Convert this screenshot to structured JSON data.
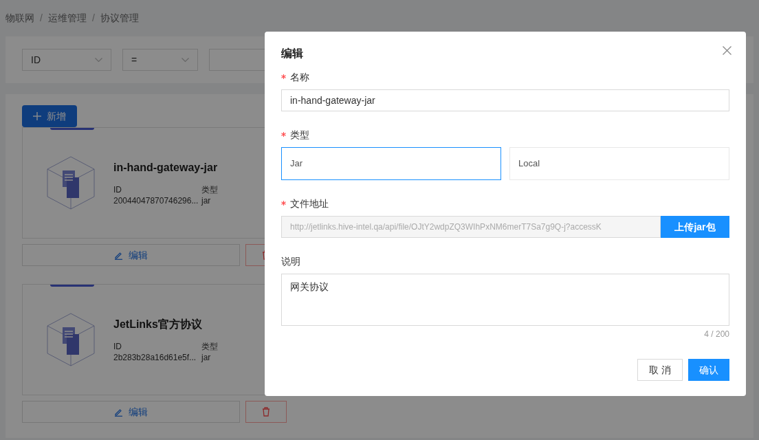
{
  "breadcrumb": [
    "物联网",
    "运维管理",
    "协议管理"
  ],
  "breadcrumb_separator": "/",
  "filter": {
    "field": "ID",
    "operator": "="
  },
  "add_button": "新增",
  "cards": [
    {
      "name": "in-hand-gateway-jar",
      "id_label": "ID",
      "id": "20044047870746296...",
      "type_label": "类型",
      "type": "jar",
      "edit": "编辑"
    },
    {
      "name": "JetLinks官方协议",
      "id_label": "ID",
      "id": "2b283b28a16d61e5f...",
      "type_label": "类型",
      "type": "jar",
      "edit": "编辑"
    }
  ],
  "modal": {
    "title": "编辑",
    "name_field": {
      "label": "名称",
      "required": true,
      "value": "in-hand-gateway-jar"
    },
    "type_field": {
      "label": "类型",
      "required": true,
      "options": [
        {
          "label": "Jar",
          "selected": true
        },
        {
          "label": "Local",
          "selected": false
        }
      ]
    },
    "file_field": {
      "label": "文件地址",
      "required": true,
      "value": "http://jetlinks.hive-intel.qa/api/file/OJtY2wdpZQ3WIhPxNM6merT7Sa7g9Q-j?accessK",
      "disabled": true,
      "upload": "上传jar包"
    },
    "desc_field": {
      "label": "说明",
      "value": "网关协议",
      "count": "4 / 200"
    },
    "cancel": "取 消",
    "confirm": "确认"
  }
}
